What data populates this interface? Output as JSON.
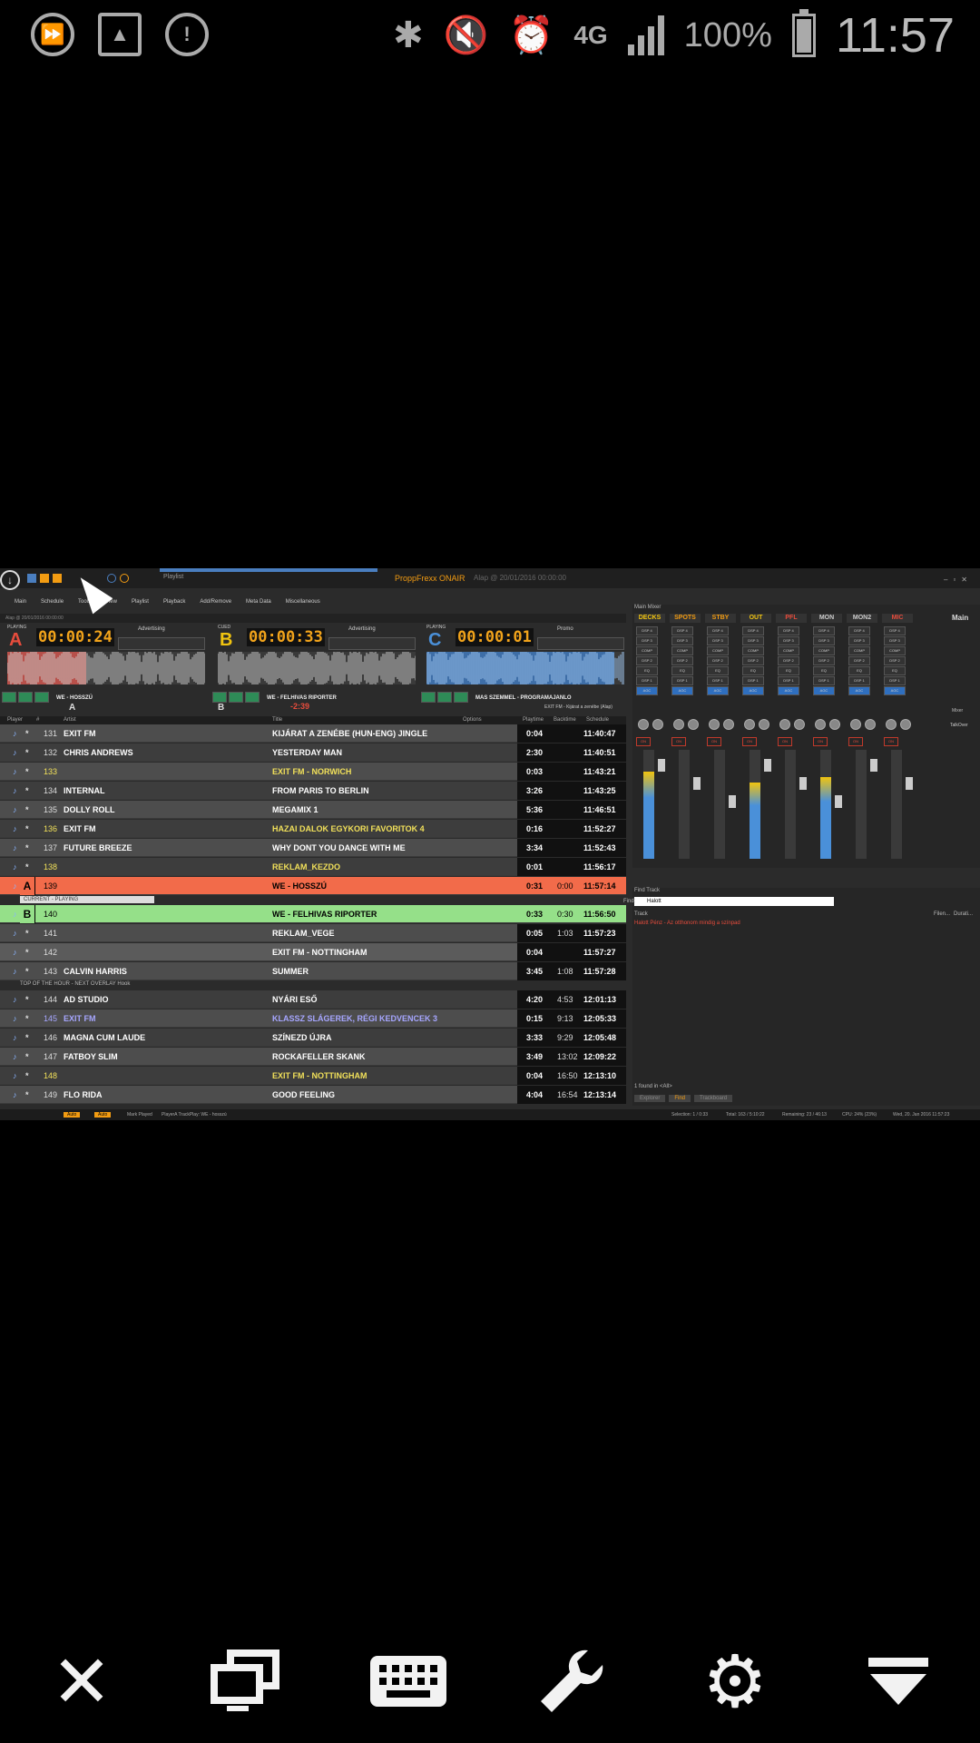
{
  "status_bar": {
    "battery_pct": "100%",
    "battery_level": 0.92,
    "clock": "11:57",
    "network": "4G",
    "icons": [
      "skip-forward-icon",
      "image-icon",
      "shield-alert-icon",
      "bluetooth-icon",
      "mute-icon",
      "alarm-icon",
      "signal-icon",
      "battery-icon"
    ]
  },
  "app": {
    "title": "ProppFrexx ONAIR",
    "subtitle": "Alap @ 20/01/2016 00:00:00",
    "tab_label": "Playlist",
    "menu": [
      "Main",
      "Schedule",
      "Tools",
      "View",
      "Playlist",
      "Playback",
      "Add/Remove",
      "Meta Data",
      "Miscellaneous"
    ],
    "deck_path": "Alap @ 20/01/2016 00:00:00"
  },
  "decks": [
    {
      "letter": "A",
      "state": "PLAYING",
      "time": "00:00:24",
      "category": "Advertising",
      "title": "WE - HOSSZÚ",
      "color": "#e74c3c",
      "progress": 0.4
    },
    {
      "letter": "B",
      "state": "CUED",
      "time": "00:00:33",
      "category": "Advertising",
      "title": "WE - FELHIVAS RIPORTER",
      "color": "#f1c40f",
      "progress": 0.0
    },
    {
      "letter": "C",
      "state": "PLAYING",
      "time": "00:00:01",
      "category": "Promo",
      "title": "MAS SZEMMEL - PROGRAMAJANLO",
      "color": "#4a90d9",
      "progress": 0.95
    }
  ],
  "scrub": {
    "a": "A",
    "b": "B",
    "countdown": "-2:39",
    "note": "EXIT FM - Kijárat a zenébe (Alap)"
  },
  "playlist": {
    "headers": [
      "Player",
      "#",
      "Artist",
      "Title",
      "Options",
      "Playtime",
      "Backtime",
      "Schedule"
    ],
    "rows": [
      {
        "num": "131",
        "artist": "EXIT FM",
        "title": "KIJÁRAT A ZENÉBE (HUN-ENG) JINGLE",
        "play": "0:04",
        "back": "",
        "sched": "11:40:47"
      },
      {
        "num": "132",
        "artist": "CHRIS ANDREWS",
        "title": "YESTERDAY MAN",
        "play": "2:30",
        "back": "",
        "sched": "11:40:51"
      },
      {
        "num": "133",
        "artist": "",
        "title": "EXIT FM - NORWICH",
        "play": "0:03",
        "back": "",
        "sched": "11:43:21"
      },
      {
        "num": "134",
        "artist": "INTERNAL",
        "title": "FROM PARIS TO BERLIN",
        "play": "3:26",
        "back": "",
        "sched": "11:43:25"
      },
      {
        "num": "135",
        "artist": "DOLLY ROLL",
        "title": "MEGAMIX 1",
        "play": "5:36",
        "back": "",
        "sched": "11:46:51"
      },
      {
        "num": "136",
        "artist": "EXIT FM",
        "title": "HAZAI DALOK EGYKORI FAVORITOK 4",
        "play": "0:16",
        "back": "",
        "sched": "11:52:27"
      },
      {
        "num": "137",
        "artist": "FUTURE BREEZE",
        "title": "WHY DONT YOU DANCE WITH ME",
        "play": "3:34",
        "back": "",
        "sched": "11:52:43"
      },
      {
        "num": "138",
        "artist": "",
        "title": "REKLAM_KEZDO",
        "play": "0:01",
        "back": "",
        "sched": "11:56:17"
      },
      {
        "num": "139",
        "artist": "",
        "title": "WE - HOSSZÚ",
        "play": "0:31",
        "back": "0:00",
        "sched": "11:57:14"
      },
      {
        "num": "140",
        "artist": "",
        "title": "WE - FELHIVAS RIPORTER",
        "play": "0:33",
        "back": "0:30",
        "sched": "11:56:50"
      },
      {
        "num": "141",
        "artist": "",
        "title": "REKLAM_VEGE",
        "play": "0:05",
        "back": "1:03",
        "sched": "11:57:23"
      },
      {
        "num": "142",
        "artist": "",
        "title": "EXIT FM - NOTTINGHAM",
        "play": "0:04",
        "back": "",
        "sched": "11:57:27"
      },
      {
        "num": "143",
        "artist": "CALVIN HARRIS",
        "title": "SUMMER",
        "play": "3:45",
        "back": "1:08",
        "sched": "11:57:28"
      },
      {
        "num": "144",
        "artist": "AD STUDIO",
        "title": "NYÁRI ESŐ",
        "play": "4:20",
        "back": "4:53",
        "sched": "12:01:13"
      },
      {
        "num": "145",
        "artist": "EXIT FM",
        "title": "KLASSZ SLÁGEREK, RÉGI KEDVENCEK 3",
        "play": "0:15",
        "back": "9:13",
        "sched": "12:05:33"
      },
      {
        "num": "146",
        "artist": "MAGNA CUM LAUDE",
        "title": "SZÍNEZD ÚJRA",
        "play": "3:33",
        "back": "9:29",
        "sched": "12:05:48"
      },
      {
        "num": "147",
        "artist": "FATBOY SLIM",
        "title": "ROCKAFELLER SKANK",
        "play": "3:49",
        "back": "13:02",
        "sched": "12:09:22"
      },
      {
        "num": "148",
        "artist": "",
        "title": "EXIT FM - NOTTINGHAM",
        "play": "0:04",
        "back": "16:50",
        "sched": "12:13:10"
      },
      {
        "num": "149",
        "artist": "FLO RIDA",
        "title": "GOOD FEELING",
        "play": "4:04",
        "back": "16:54",
        "sched": "12:13:14"
      }
    ],
    "current_label": "CURRENT - PLAYING",
    "note_top_of_hour": "TOP OF THE HOUR - NEXT OVERLAY Hook"
  },
  "statusline": {
    "auto": "Auto",
    "mark": "Mark Played",
    "play_info": "PlayerA TrackPlay: WE - hosszú",
    "selection": "Selection: 1 / 0:33",
    "total": "Total: 163 / 5:10:22",
    "remaining": "Remaining: 23 / 46:13",
    "cpu": "CPU: 24% (23%)",
    "date": "Wed, 20. Jan 2016 11:57:23"
  },
  "mixer": {
    "title": "Main Mixer",
    "channels": [
      {
        "label": "DECKS",
        "color": "#f1c40f",
        "level": 0.8
      },
      {
        "label": "SPOTS",
        "color": "#f39c12",
        "level": 0.0
      },
      {
        "label": "STBY",
        "color": "#f39c12",
        "level": 0.0
      },
      {
        "label": "OUT",
        "color": "#f1c40f",
        "level": 0.7
      },
      {
        "label": "PFL",
        "color": "#e74c3c",
        "level": 0.0
      },
      {
        "label": "MON",
        "color": "#ccc",
        "level": 0.75
      },
      {
        "label": "MON2",
        "color": "#ccc",
        "level": 0.0
      },
      {
        "label": "MIC",
        "color": "#e74c3c",
        "level": 0.0
      }
    ],
    "main_label": "Main",
    "talkover": "TalkOver",
    "mixer_label": "Mixer"
  },
  "find": {
    "title": "Find Track",
    "field_label": "Find:",
    "query": "Halott",
    "col_track": "Track",
    "col_filename": "Filen...",
    "col_duration": "Durati...",
    "result": "Halott Pénz - Az otthonom mindig a színpad",
    "footer": "1 found in <All>",
    "tabs": [
      "Explorer",
      "Find",
      "Trackboard"
    ]
  },
  "bottom_toolbar": [
    "close-icon",
    "monitors-icon",
    "keyboard-icon",
    "wrench-icon",
    "gear-icon",
    "dropdown-icon"
  ]
}
